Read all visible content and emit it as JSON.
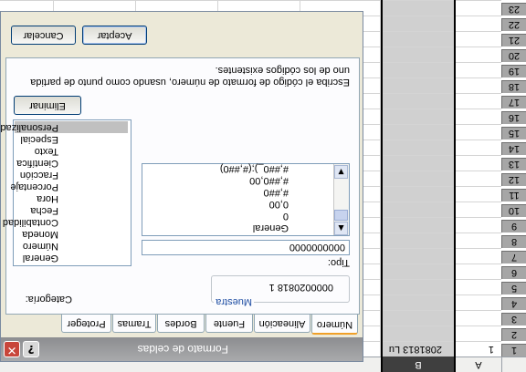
{
  "spreadsheet": {
    "columns": [
      "A",
      "B"
    ],
    "rows": [
      "1",
      "2",
      "3",
      "4",
      "5",
      "6",
      "7",
      "8",
      "9",
      "10",
      "11",
      "12",
      "13",
      "14",
      "15",
      "16",
      "17",
      "18",
      "19",
      "20",
      "21",
      "22",
      "23"
    ],
    "cell_a1": "1",
    "cell_b1": "2081813 Lu"
  },
  "dialog": {
    "title": "Formato de celdas",
    "help_label": "?",
    "close_label": "✕",
    "tabs": [
      "Número",
      "Alineación",
      "Fuente",
      "Bordes",
      "Tramas",
      "Proteger"
    ],
    "active_tab": "Número",
    "category_label": "Categoría:",
    "categories": [
      "General",
      "Número",
      "Moneda",
      "Contabilidad",
      "Fecha",
      "Hora",
      "Porcentaje",
      "Fracción",
      "Científica",
      "Texto",
      "Especial",
      "Personalizada"
    ],
    "selected_category": "Personalizada",
    "sample_legend": "Muestra",
    "sample_value": "0000020818 1",
    "type_label": "Tipo:",
    "type_value": "0000000000",
    "type_options": [
      "General",
      "0",
      "0,00",
      "#,##0",
      "#,##0,00",
      "#,##0_);(#,##0)"
    ],
    "delete_button": "Eliminar",
    "description": "Escriba el código de formato de número, usando como punto de partida uno de los códigos existentes.",
    "ok_button": "Aceptar",
    "cancel_button": "Cancelar"
  },
  "colors": {
    "title_bar": "#8c8d90",
    "close_button": "#c8453a",
    "active_tab_accent": "#f0a028",
    "selected_column_header": "#3f3f3f",
    "row_header": "#a6a6a6"
  }
}
